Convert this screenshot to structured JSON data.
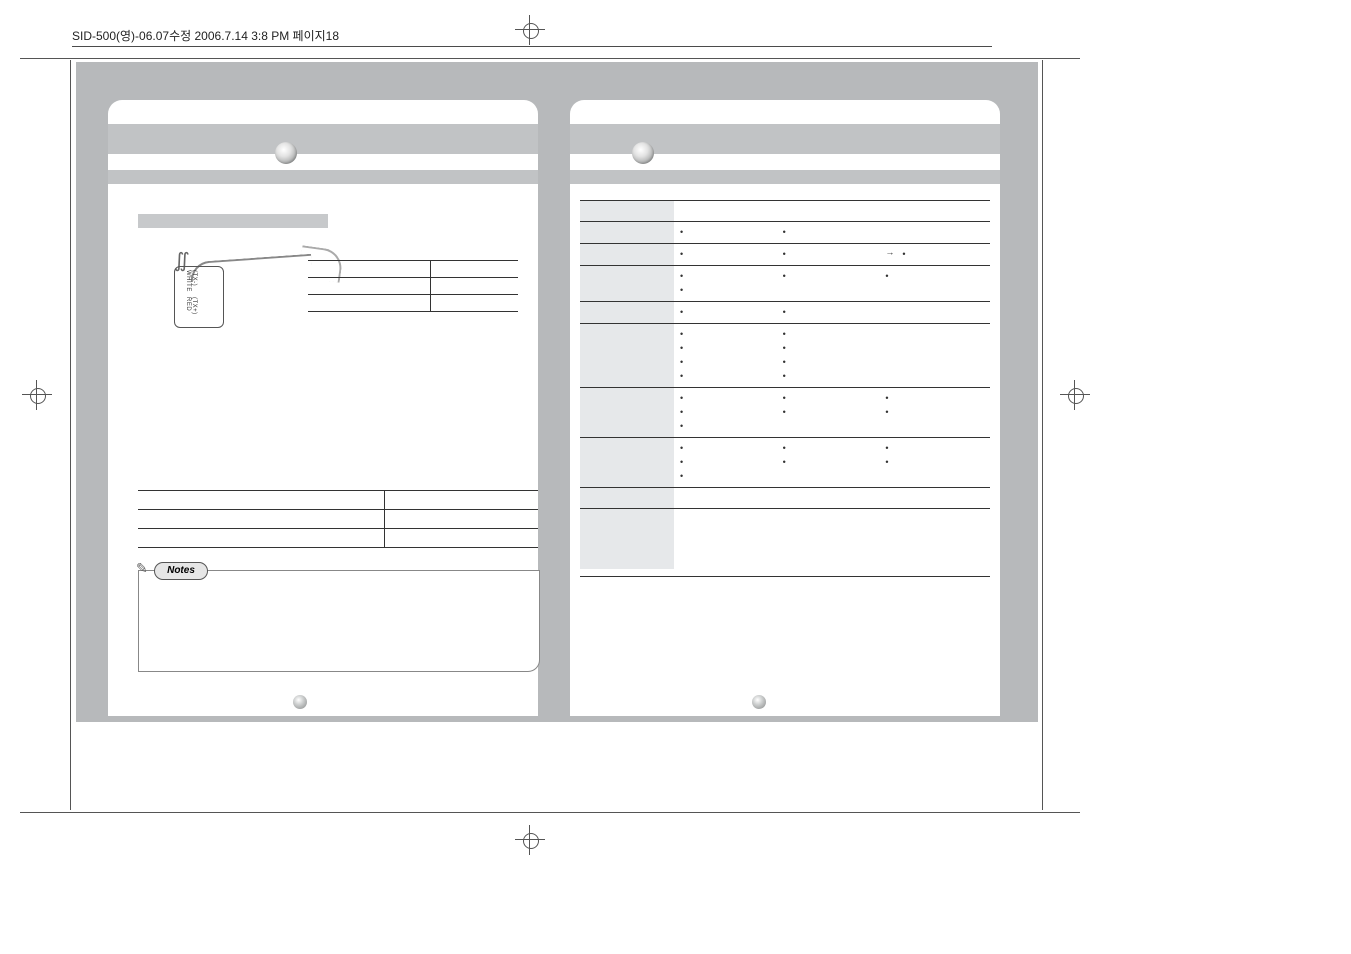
{
  "header": {
    "filename": "SID-500(영)-06.07수정  2006.7.14 3:8 PM  페이지18"
  },
  "left_page": {
    "connector": {
      "wire_white": "WHITE (TX-)",
      "wire_red": "RED (TX+)"
    },
    "mini_table": {
      "rows": [
        {
          "l": "",
          "r": ""
        },
        {
          "l": "",
          "r": ""
        },
        {
          "l": "",
          "r": ""
        }
      ]
    },
    "big_table": {
      "rows": [
        {
          "l": "",
          "r": ""
        },
        {
          "l": "",
          "r": ""
        },
        {
          "l": "",
          "r": ""
        }
      ]
    },
    "notes_label": "Notes"
  },
  "right_page": {
    "rows": [
      {
        "lines": [
          [
            "",
            "",
            ""
          ]
        ]
      },
      {
        "lines": [
          [
            "",
            "",
            ""
          ],
          [
            "",
            "→",
            ""
          ]
        ]
      },
      {
        "lines": [
          [
            "",
            "",
            ""
          ],
          [
            "",
            "",
            ""
          ]
        ]
      },
      {
        "lines": [
          [
            "",
            "",
            ""
          ]
        ]
      },
      {
        "lines": [
          [
            "",
            "",
            ""
          ],
          [
            "",
            "",
            ""
          ],
          [
            "",
            "",
            ""
          ],
          [
            "",
            "",
            ""
          ]
        ]
      },
      {
        "lines": [
          [
            "",
            "",
            ""
          ],
          [
            "",
            "",
            ""
          ],
          [
            "",
            "",
            ""
          ]
        ]
      },
      {
        "lines": [
          [
            "",
            "",
            ""
          ],
          [
            "",
            "",
            ""
          ],
          [
            "",
            "",
            ""
          ]
        ]
      },
      {
        "lines": [
          [
            "",
            "",
            ""
          ]
        ]
      }
    ]
  }
}
